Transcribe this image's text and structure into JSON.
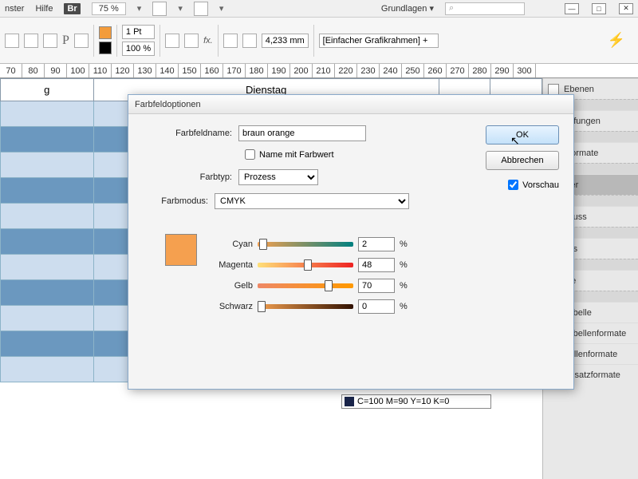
{
  "menubar": {
    "item1": "nster",
    "item2": "Hilfe",
    "br": "Br",
    "zoom": "75 %",
    "grundlagen": "Grundlagen",
    "search_icon": "⌕"
  },
  "toolbar": {
    "stroke": "1 Pt",
    "percent": "100 %",
    "measure": "4,233 mm",
    "frame_label": "[Einfacher Grafikrahmen] +"
  },
  "ruler": [
    "70",
    "80",
    "90",
    "100",
    "110",
    "120",
    "130",
    "140",
    "150",
    "160",
    "170",
    "180",
    "190",
    "200",
    "210",
    "220",
    "230",
    "240",
    "250",
    "260",
    "270",
    "280",
    "290",
    "300"
  ],
  "table": {
    "col1": "g",
    "col2": "Dienstag"
  },
  "panels": {
    "items": [
      "Ebenen",
      "upfungen",
      "nformate",
      "lder",
      "nfluss",
      "nks",
      "ute",
      "Tabelle",
      "Tabellenformate",
      "Zellenformate",
      "Absatzformate"
    ],
    "selected_index": 3
  },
  "dialog": {
    "title": "Farbfeldoptionen",
    "name_label": "Farbfeldname:",
    "name_value": "braun orange",
    "name_with_value": "Name mit Farbwert",
    "type_label": "Farbtyp:",
    "type_value": "Prozess",
    "mode_label": "Farbmodus:",
    "mode_value": "CMYK",
    "ok": "OK",
    "cancel": "Abbrechen",
    "preview": "Vorschau",
    "sliders": {
      "cyan": {
        "label": "Cyan",
        "value": "2",
        "pct": 2
      },
      "magenta": {
        "label": "Magenta",
        "value": "48",
        "pct": 48
      },
      "yellow": {
        "label": "Gelb",
        "value": "70",
        "pct": 70
      },
      "black": {
        "label": "Schwarz",
        "value": "0",
        "pct": 0
      }
    },
    "pct_sign": "%"
  },
  "status_swatch": "C=100 M=90 Y=10 K=0"
}
